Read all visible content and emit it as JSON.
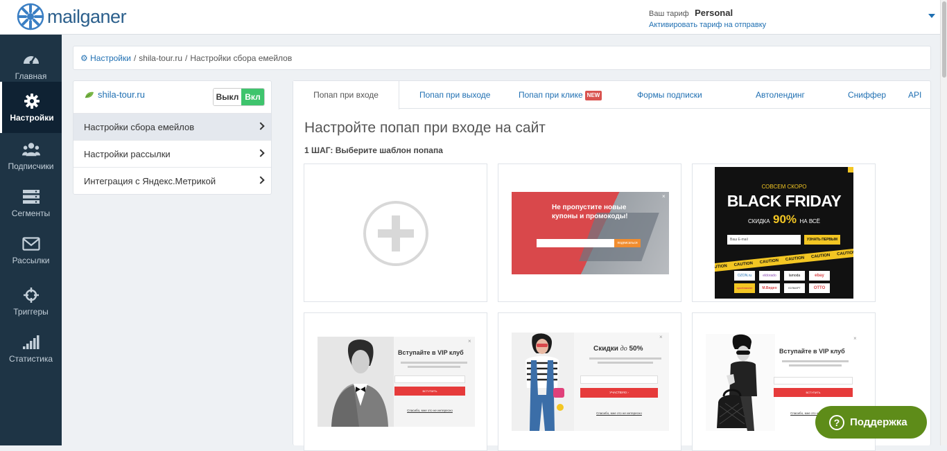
{
  "header": {
    "logo_text": "mailganer",
    "tariff_label": "Ваш тариф",
    "tariff_plan": "Personal",
    "tariff_link": "Активировать тариф на отправку"
  },
  "sidebar": {
    "items": [
      {
        "label": "Главная",
        "icon": "dashboard-icon"
      },
      {
        "label": "Настройки",
        "icon": "gear-icon"
      },
      {
        "label": "Подписчики",
        "icon": "users-icon"
      },
      {
        "label": "Сегменты",
        "icon": "segments-icon"
      },
      {
        "label": "Рассылки",
        "icon": "envelope-icon"
      },
      {
        "label": "Триггеры",
        "icon": "crosshair-icon"
      },
      {
        "label": "Статистика",
        "icon": "signal-icon"
      }
    ]
  },
  "breadcrumb": {
    "settings": "Настройки",
    "site": "shila-tour.ru",
    "current": "Настройки сбора емейлов"
  },
  "left_panel": {
    "site_name": "shila-tour.ru",
    "toggle_off": "Выкл",
    "toggle_on": "Вкл",
    "menu": [
      {
        "label": "Настройки сбора емейлов"
      },
      {
        "label": "Настройки рассылки"
      },
      {
        "label": "Интеграция с Яндекс.Метрикой"
      }
    ]
  },
  "tabs": [
    {
      "label": "Попап при входе"
    },
    {
      "label": "Попап при выходе"
    },
    {
      "label": "Попап при клике",
      "badge": "NEW"
    },
    {
      "label": "Формы подписки"
    },
    {
      "label": "Автолендинг"
    },
    {
      "label": "Сниффер"
    },
    {
      "label": "API"
    }
  ],
  "content": {
    "heading": "Настройте попап при входе на сайт",
    "step": "1 ШАГ: Выберите шаблон попапа"
  },
  "templates": {
    "coupons": {
      "title_line1": "Не пропустите новые",
      "title_line2": "купоны и промокоды!",
      "button": "подписаться"
    },
    "black_friday": {
      "top": "СОВСЕМ СКОРО",
      "title": "BLACK FRIDAY",
      "discount_prefix": "СКИДКА",
      "discount": "90%",
      "discount_suffix": "НА ВСЁ",
      "input": "Ваш E-mail",
      "button": "УЗНАТЬ ПЕРВЫМ",
      "tape": "CAUTION",
      "brands": [
        "OZON.ru",
        "eldorado",
        "lamoda",
        "ebay",
        "sportmaster",
        "М.Видео",
        "ЮЛМАРТ",
        "OTTO"
      ]
    },
    "vip_man": {
      "title": "Вступайте в VIP клуб",
      "button": "ВСТУПИТЬ",
      "footer": "Спасибо, мне это не интересно"
    },
    "sale": {
      "title_prefix": "Скидки",
      "title_italic": "до",
      "title_value": "50%",
      "button": "УЧАСТВУЮ ›",
      "footer": "Спасибо, мне это не интересно"
    },
    "vip_woman": {
      "title": "Вступайте в VIP клуб",
      "button": "ВСТУПИТЬ",
      "footer": "Спасибо, мне это не интересно"
    }
  },
  "support": {
    "label": "Поддержка"
  },
  "colors": {
    "sidebar": "#1e3445",
    "accent": "#1f6fb2",
    "toggle_on": "#3ec46d",
    "support": "#5e8c19",
    "badge": "#d9534f"
  }
}
